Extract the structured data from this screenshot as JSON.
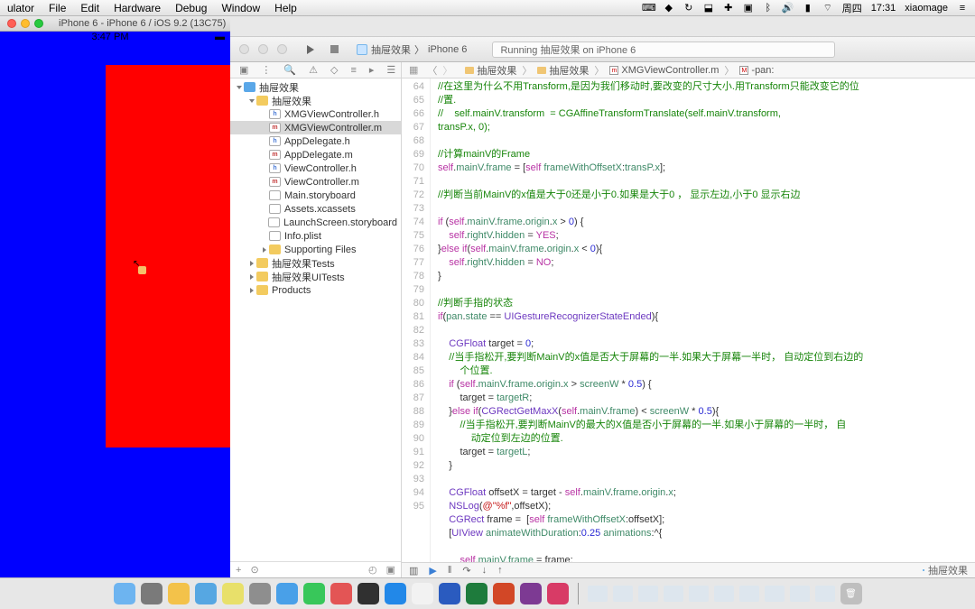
{
  "menubar": {
    "items": [
      "ulator",
      "File",
      "Edit",
      "Hardware",
      "Debug",
      "Window",
      "Help"
    ],
    "status": {
      "day": "周四",
      "time": "17:31",
      "user": "xiaomage"
    }
  },
  "simulator": {
    "title": "iPhone 6 - iPhone 6 / iOS 9.2 (13C75)",
    "statusbar": {
      "carrier": "",
      "time": "3:47 PM",
      "battery": ""
    }
  },
  "xcode": {
    "toolbar": {
      "scheme_app": "抽屉效果",
      "scheme_device": "iPhone 6",
      "activity": "Running 抽屉效果 on iPhone 6"
    },
    "jumpbar": {
      "crumbs": [
        "抽屉效果",
        "抽屉效果",
        "XMGViewController.m",
        "-pan:"
      ],
      "icons": [
        "folder",
        "folder",
        "m",
        "m"
      ]
    },
    "navigator": [
      {
        "indent": 0,
        "icon": "proj",
        "label": "抽屉效果",
        "disclosure": "open"
      },
      {
        "indent": 1,
        "icon": "folder",
        "label": "抽屉效果",
        "disclosure": "open"
      },
      {
        "indent": 2,
        "icon": "h",
        "label": "XMGViewController.h"
      },
      {
        "indent": 2,
        "icon": "m",
        "label": "XMGViewController.m",
        "selected": true
      },
      {
        "indent": 2,
        "icon": "h",
        "label": "AppDelegate.h"
      },
      {
        "indent": 2,
        "icon": "m",
        "label": "AppDelegate.m"
      },
      {
        "indent": 2,
        "icon": "h",
        "label": "ViewController.h"
      },
      {
        "indent": 2,
        "icon": "m",
        "label": "ViewController.m"
      },
      {
        "indent": 2,
        "icon": "sb",
        "label": "Main.storyboard"
      },
      {
        "indent": 2,
        "icon": "assets",
        "label": "Assets.xcassets"
      },
      {
        "indent": 2,
        "icon": "sb",
        "label": "LaunchScreen.storyboard"
      },
      {
        "indent": 2,
        "icon": "plist",
        "label": "Info.plist"
      },
      {
        "indent": 2,
        "icon": "folder",
        "label": "Supporting Files",
        "disclosure": "closed"
      },
      {
        "indent": 1,
        "icon": "folder",
        "label": "抽屉效果Tests",
        "disclosure": "closed"
      },
      {
        "indent": 1,
        "icon": "folder",
        "label": "抽屉效果UITests",
        "disclosure": "closed"
      },
      {
        "indent": 1,
        "icon": "folder",
        "label": "Products",
        "disclosure": "closed"
      }
    ],
    "code": {
      "first_line": 64,
      "lines": [
        "{cmt://在这里为什么不用Transform,是因为我们移动时,要改变的尺寸大小.用Transform只能改变它的位}",
        "{cmt://置.}",
        "{cmt://    self.mainV.transform  = CGAffineTransformTranslate(self.mainV.transform, }",
        "{cmt:transP.x, 0);}",
        "",
        "{cmt://计算mainV的Frame}",
        "{self:self}.{prop:mainV}.{prop:frame} = [{self:self} {prop:frameWithOffsetX}:{prop:transP}.{prop:x}];",
        "",
        "{cmt://判断当前MainV的x值是大于0还是小于0.如果是大于0 ， 显示左边,小于0 显示右边}",
        "",
        "{kw:if} ({self:self}.{prop:mainV}.{prop:frame}.{prop:origin}.{prop:x} > {num:0}) {",
        "    {self:self}.{prop:rightV}.{prop:hidden} = {kw:YES};",
        "}{kw:else} {kw:if}({self:self}.{prop:mainV}.{prop:frame}.{prop:origin}.{prop:x} < {num:0}){",
        "    {self:self}.{prop:rightV}.{prop:hidden} = {kw:NO};",
        "}",
        "",
        "{cmt://判断手指的状态}",
        "{kw:if}({prop:pan}.{prop:state} == {const:UIGestureRecognizerStateEnded}){",
        "",
        "    {type:CGFloat} target = {num:0};",
        "    {cmt://当手指松开,要判断MainV的x值是否大于屏幕的一半.如果大于屏幕一半时， 自动定位到右边的}",
        "        {cmt:个位置.}",
        "    {kw:if} ({self:self}.{prop:mainV}.{prop:frame}.{prop:origin}.{prop:x} > {prop:screenW} * {num:0.5}) {",
        "        target = {prop:targetR};",
        "    }{kw:else} {kw:if}({const:CGRectGetMaxX}({self:self}.{prop:mainV}.{prop:frame}) < {prop:screenW} * {num:0.5}){",
        "        {cmt://当手指松开,要判断MainV的最大的X值是否小于屏幕的一半.如果小于屏幕的一半时， 自}",
        "            {cmt:动定位到左边的位置.}",
        "        target = {prop:targetL};",
        "    }",
        "",
        "    {type:CGFloat} offsetX = target - {self:self}.{prop:mainV}.{prop:frame}.{prop:origin}.{prop:x};",
        "    {const:NSLog}({str:@\"%f\"},offsetX);",
        "    {type:CGRect} frame =  [{self:self} {prop:frameWithOffsetX}:offsetX];",
        "    [{const:UIView} {prop:animateWithDuration}:{num:0.25} {prop:animations}:^{",
        "",
        "        {self:self}.{prop:mainV}.{prop:frame} = frame;"
      ],
      "explicit_line_numbers": [
        64,
        65,
        null,
        66,
        67,
        68,
        69,
        70,
        71,
        72,
        73,
        74,
        75,
        76,
        77,
        78,
        79,
        80,
        81,
        82,
        null,
        83,
        84,
        85,
        86,
        null,
        87,
        88,
        89,
        90,
        91,
        92,
        93,
        94,
        95
      ]
    },
    "debugbar": {
      "crumb": "抽屉效果"
    }
  },
  "dock": {
    "apps": [
      "finder",
      "launchpad",
      "chrome",
      "mail",
      "notes",
      "settings",
      "safari",
      "facetime",
      "screen",
      "terminal",
      "xcode",
      "pages",
      "word",
      "excel",
      "ppt",
      "onenote",
      "teams"
    ],
    "mins": [
      "w",
      "w",
      "w",
      "w",
      "w",
      "w",
      "w",
      "w",
      "w",
      "w"
    ],
    "trash": "trash"
  }
}
